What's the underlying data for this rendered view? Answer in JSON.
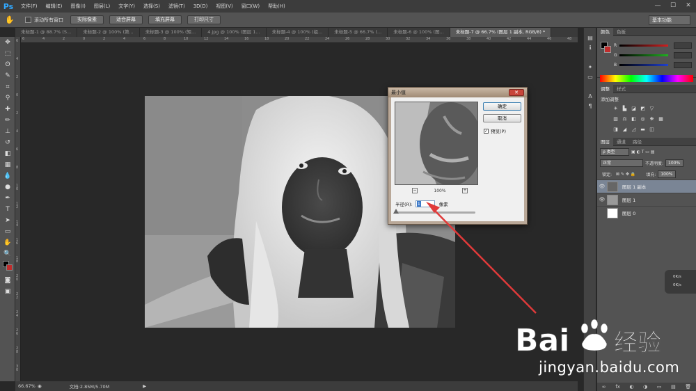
{
  "app": {
    "logo": "Ps"
  },
  "menu": [
    "文件(F)",
    "编辑(E)",
    "图像(I)",
    "图层(L)",
    "文字(Y)",
    "选择(S)",
    "滤镜(T)",
    "3D(D)",
    "视图(V)",
    "窗口(W)",
    "帮助(H)"
  ],
  "window_controls": [
    "—",
    "☐",
    "✕"
  ],
  "options": {
    "scroll_all_label": "滚动所有窗口",
    "buttons": [
      "实际像素",
      "适合屏幕",
      "填充屏幕",
      "打印尺寸"
    ],
    "workspace": "基本功能"
  },
  "tabs": [
    {
      "label": "未标题-1 @ 88.7% (S...",
      "active": false
    },
    {
      "label": "未标题-2 @ 100% (第...",
      "active": false
    },
    {
      "label": "未标题-3 @ 100% (矩...",
      "active": false
    },
    {
      "label": "4.jpg @ 100% (图层 1...",
      "active": false
    },
    {
      "label": "未标题-4 @ 100% (组...",
      "active": false
    },
    {
      "label": "未标题-5 @ 66.7% (...",
      "active": false
    },
    {
      "label": "未标题-6 @ 100% (图...",
      "active": false
    },
    {
      "label": "未标题-7 @ 66.7% (图层 1 副本, RGB/8) *",
      "active": true
    }
  ],
  "ruler_h": [
    "6",
    "4",
    "2",
    "0",
    "2",
    "4",
    "6",
    "8",
    "10",
    "12",
    "14",
    "16",
    "18",
    "20",
    "22",
    "24",
    "26",
    "28",
    "30",
    "32",
    "34",
    "36",
    "38",
    "40",
    "42",
    "44",
    "46",
    "48"
  ],
  "ruler_v": [
    "6",
    "4",
    "2",
    "0",
    "2",
    "4",
    "6",
    "8",
    "1\n0",
    "1\n2",
    "1\n4",
    "1\n6",
    "1\n8",
    "2\n0",
    "2\n2",
    "2\n4",
    "2\n6",
    "2\n8",
    "3\n0"
  ],
  "status": {
    "zoom": "66.67%",
    "doc": "文档:2.85M/5.70M"
  },
  "color_panel": {
    "tabs": [
      "颜色",
      "色板"
    ],
    "sliders": [
      {
        "label": "R",
        "color": "#d02020"
      },
      {
        "label": "G",
        "color": "#20b020"
      },
      {
        "label": "B",
        "color": "#2040d0"
      }
    ]
  },
  "adjustments": {
    "tabs": [
      "调整",
      "样式"
    ],
    "title": "添加调整"
  },
  "layers_panel": {
    "tabs": [
      "图层",
      "通道",
      "路径"
    ],
    "kind": "ρ 类型",
    "blend": "正常",
    "opacity_label": "不透明度:",
    "opacity_value": "100%",
    "lock_label": "锁定:",
    "fill_label": "填充:",
    "fill_value": "100%",
    "layers": [
      {
        "name": "图层 1 副本",
        "selected": true
      },
      {
        "name": "图层 1",
        "selected": false
      },
      {
        "name": "图层 0",
        "selected": false
      }
    ],
    "footer_icons": [
      "∞",
      "fx",
      "◐",
      "◑",
      "▭",
      "▤",
      "🗑"
    ]
  },
  "side_widget": {
    "line1": "0K/s",
    "line2": "0K/s"
  },
  "dialog": {
    "title": "最小值",
    "close": "✕",
    "ok": "确定",
    "cancel": "取消",
    "preview_label": "预览(P)",
    "preview_checked": "✓",
    "zoom_out": "−",
    "zoom_in": "+",
    "zoom_level": "100%",
    "radius_label": "半径(R):",
    "radius_value": "1",
    "radius_unit": "像素"
  },
  "watermark": {
    "url": "jingyan.baidu.com"
  }
}
